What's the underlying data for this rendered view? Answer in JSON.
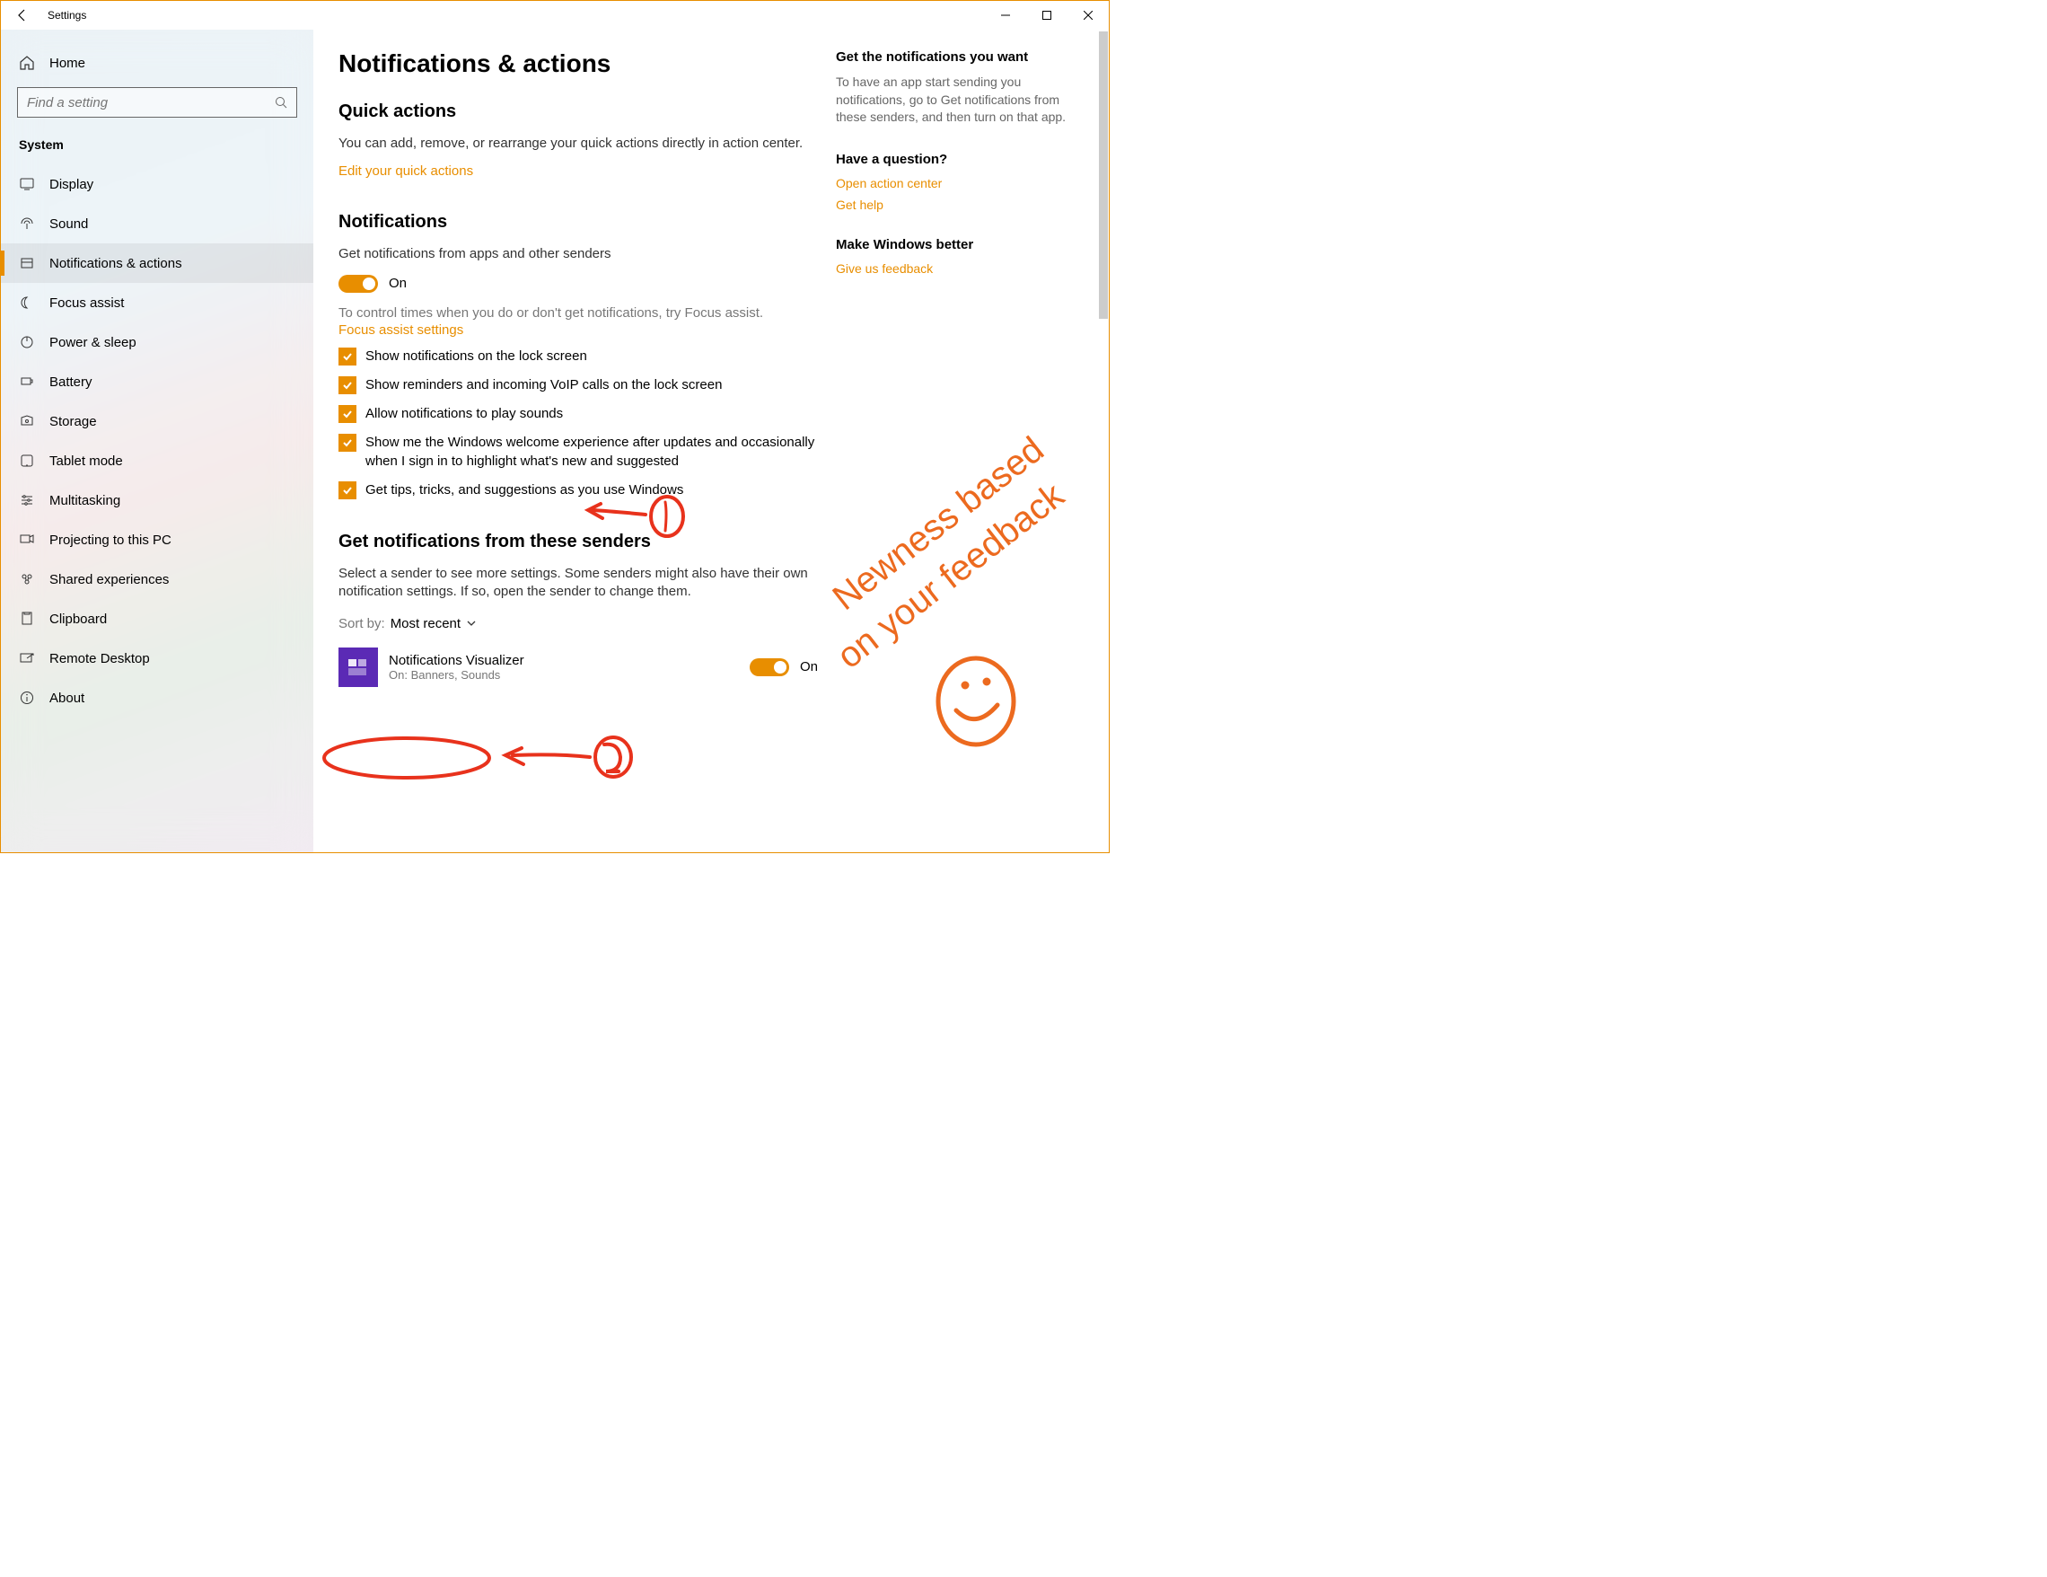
{
  "window": {
    "title": "Settings"
  },
  "sidebar": {
    "home": "Home",
    "search_placeholder": "Find a setting",
    "section": "System",
    "items": [
      {
        "label": "Display"
      },
      {
        "label": "Sound"
      },
      {
        "label": "Notifications & actions"
      },
      {
        "label": "Focus assist"
      },
      {
        "label": "Power & sleep"
      },
      {
        "label": "Battery"
      },
      {
        "label": "Storage"
      },
      {
        "label": "Tablet mode"
      },
      {
        "label": "Multitasking"
      },
      {
        "label": "Projecting to this PC"
      },
      {
        "label": "Shared experiences"
      },
      {
        "label": "Clipboard"
      },
      {
        "label": "Remote Desktop"
      },
      {
        "label": "About"
      }
    ]
  },
  "page": {
    "title": "Notifications & actions",
    "quick": {
      "heading": "Quick actions",
      "desc": "You can add, remove, or rearrange your quick actions directly in action center.",
      "link": "Edit your quick actions"
    },
    "notifications": {
      "heading": "Notifications",
      "toggle_label": "Get notifications from apps and other senders",
      "toggle_state": "On",
      "hint": "To control times when you do or don't get notifications, try Focus assist.",
      "focus_link": "Focus assist settings",
      "checks": [
        "Show notifications on the lock screen",
        "Show reminders and incoming VoIP calls on the lock screen",
        "Allow notifications to play sounds",
        "Show me the Windows welcome experience after updates and occasionally when I sign in to highlight what's new and suggested",
        "Get tips, tricks, and suggestions as you use Windows"
      ]
    },
    "senders": {
      "heading": "Get notifications from these senders",
      "desc": "Select a sender to see more settings. Some senders might also have their own notification settings. If so, open the sender to change them.",
      "sort_label": "Sort by:",
      "sort_value": "Most recent",
      "items": [
        {
          "name": "Notifications Visualizer",
          "sub": "On: Banners, Sounds",
          "state": "On"
        }
      ]
    }
  },
  "side": {
    "block1": {
      "title": "Get the notifications you want",
      "text": "To have an app start sending you notifications, go to Get notifications from these senders, and then turn on that app."
    },
    "block2": {
      "title": "Have a question?",
      "links": [
        "Open action center",
        "Get help"
      ]
    },
    "block3": {
      "title": "Make Windows better",
      "links": [
        "Give us feedback"
      ]
    }
  },
  "annotation_text": "Newness based on your feedback"
}
